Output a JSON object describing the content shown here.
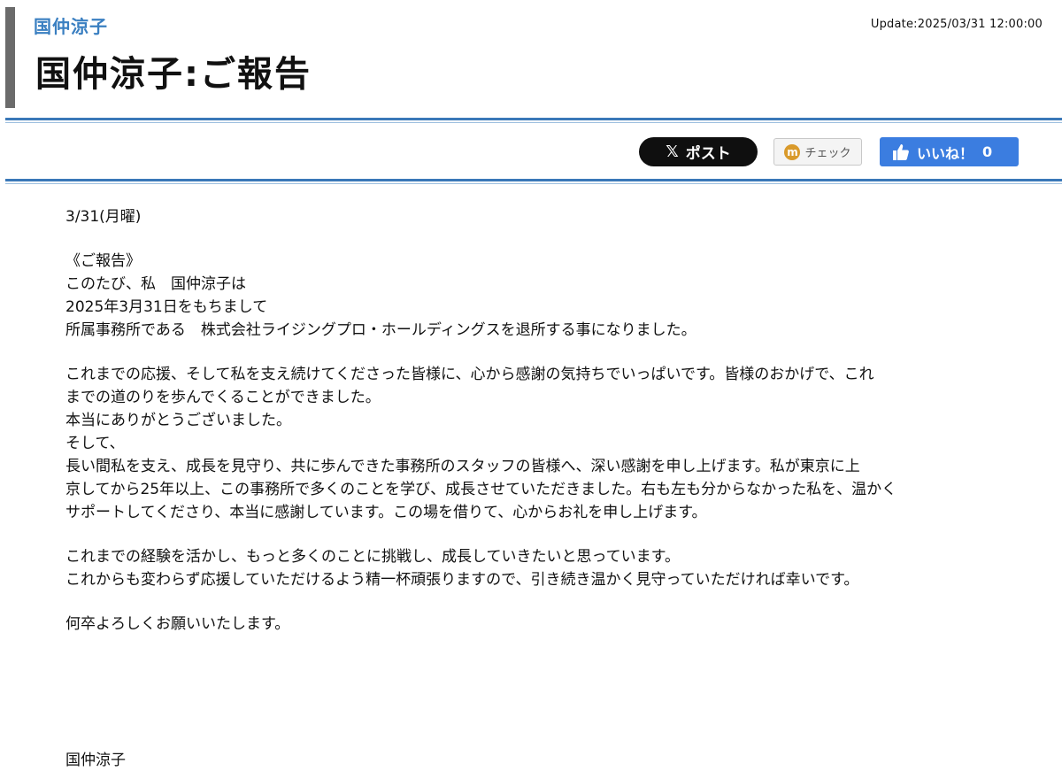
{
  "header": {
    "author_name": "国仲涼子",
    "update_text": "Update:2025/03/31 12:00:00",
    "title": "国仲涼子:ご報告"
  },
  "share": {
    "post_label": "ポスト",
    "post_icon": "x-logo-icon",
    "check_label": "チェック",
    "check_icon": "m-badge-icon",
    "like_label": "いいね！",
    "like_count": "0",
    "like_icon": "thumbs-up-icon",
    "like_color": "#3b7de0"
  },
  "article": {
    "date": "3/31(月曜)",
    "heading": "《ご報告》",
    "intro_lines": [
      "このたび、私　国仲涼子は",
      "2025年3月31日をもちまして",
      "所属事務所である　株式会社ライジングプロ・ホールディングスを退所する事になりました。"
    ],
    "thanks_lines": [
      "これまでの応援、そして私を支え続けてくださった皆様に、心から感謝の気持ちでいっぱいです。皆様のおかげで、これ",
      "までの道のりを歩んでくることができました。",
      "本当にありがとうございました。",
      "そして、",
      "長い間私を支え、成長を見守り、共に歩んできた事務所のスタッフの皆様へ、深い感謝を申し上げます。私が東京に上",
      "京してから25年以上、この事務所で多くのことを学び、成長させていただきました。右も左も分からなかった私を、温かく",
      "サポートしてくださり、本当に感謝しています。この場を借りて、心からお礼を申し上げます。"
    ],
    "future_lines": [
      "これまでの経験を活かし、もっと多くのことに挑戦し、成長していきたいと思っています。",
      "これからも変わらず応援していただけるよう精一杯頑張りますので、引き続き温かく見守っていただければ幸いです。"
    ],
    "closing": "何卒よろしくお願いいたします。",
    "signature": "国仲涼子"
  },
  "colors": {
    "accent_blue": "#3a78b8",
    "author_link": "#3a7fc1",
    "left_bar": "#6b6b6b",
    "post_button": "#0f0f0f"
  }
}
